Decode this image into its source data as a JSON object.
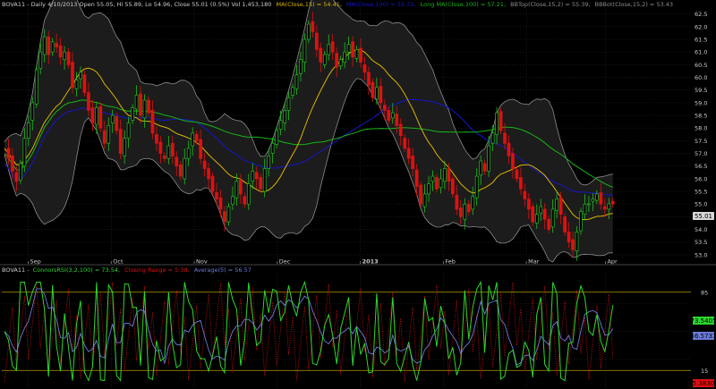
{
  "colors": {
    "background": "#000000",
    "grid": "#2a2a2a",
    "up_candle": "#1fbf1f",
    "down_candle": "#e01010",
    "bollinger": "#8c8c8c",
    "bollinger_fill": "#1c1c1c",
    "ma15": "#d8b400",
    "ma100": "#1616c8",
    "long_ma": "#18b418",
    "connors": "#2ed62e",
    "streak": "#e01010",
    "average": "#6a7ad8",
    "level_line": "#b59b00",
    "text": "#cccccc"
  },
  "price_panel": {
    "header": {
      "symbol_info": "BOVA11 - Daily 4/10/2013 Open 55.05, Hi 55.89, Lo 54.96, Close 55.01 (0.5%) Vol 1,453,180",
      "ma15": "MA(Close,15) = 54.41,",
      "ma100": "MA(Close,100) = 55.72,",
      "long_ma": "Long MA(Close,100) = 57.21,",
      "bb_top": "BBTop(Close,15,2) = 55.39,",
      "bb_bot": "BBBot(Close,15,2) = 53.43"
    },
    "last_price_label": "55.01",
    "y_ticks": [
      "62.5",
      "62.0",
      "61.5",
      "61.0",
      "60.5",
      "60.0",
      "59.5",
      "59.0",
      "58.5",
      "58.0",
      "57.5",
      "57.0",
      "56.5",
      "56.0",
      "55.5",
      "55.0",
      "54.5",
      "54.0",
      "53.5",
      "53.0"
    ],
    "x_labels": [
      "Sep",
      "Oct",
      "Nov",
      "Dec",
      "2013",
      "Feb",
      "Mar",
      "Apr"
    ]
  },
  "indicator_panel": {
    "header": {
      "symbol": "BOVA11 -",
      "connors": "ConnorsRSI(3,2,100) = 73.54,",
      "streak": "Closing Range = 5.38,",
      "average": "Average(5) = 56.57"
    },
    "levels": [
      "85",
      "15"
    ],
    "value_labels": {
      "connors": "73.5405",
      "average": "56.5731",
      "streak": "5.3830"
    }
  },
  "chart_data": [
    {
      "type": "candlestick",
      "title": "BOVA11 - Daily",
      "ylim": [
        52.75,
        62.7
      ],
      "y_ticks": [
        62.5,
        62.0,
        61.5,
        61.0,
        60.5,
        60.0,
        59.5,
        59.0,
        58.5,
        58.0,
        57.5,
        57.0,
        56.5,
        56.0,
        55.5,
        55.0,
        54.5,
        54.0,
        53.5,
        53.0
      ],
      "x_labels": [
        "Sep",
        "Oct",
        "Nov",
        "Dec",
        "2013",
        "Feb",
        "Mar",
        "Apr"
      ],
      "x_label_positions": [
        6,
        27,
        48,
        69,
        90,
        111,
        132,
        152
      ],
      "bars": 164,
      "last_close": 55.01,
      "series": [
        {
          "name": "Close",
          "values": [
            57.2,
            56.8,
            56.3,
            55.9,
            56.6,
            57.6,
            58.2,
            59.0,
            60.3,
            61.0,
            61.6,
            60.9,
            61.4,
            61.2,
            60.8,
            61.0,
            60.5,
            59.6,
            59.9,
            60.2,
            59.4,
            58.7,
            58.2,
            58.8,
            58.0,
            57.4,
            58.1,
            58.5,
            57.9,
            57.0,
            57.6,
            58.2,
            58.8,
            59.3,
            58.5,
            59.1,
            58.6,
            57.8,
            57.4,
            57.0,
            56.8,
            57.3,
            56.9,
            56.5,
            56.1,
            56.8,
            57.2,
            57.8,
            57.5,
            56.8,
            56.4,
            56.0,
            55.5,
            55.2,
            54.8,
            54.3,
            54.9,
            55.3,
            55.9,
            55.4,
            55.0,
            55.8,
            56.3,
            56.0,
            55.6,
            56.4,
            56.9,
            57.4,
            57.9,
            58.3,
            58.7,
            59.2,
            59.6,
            60.1,
            60.7,
            61.5,
            62.1,
            61.8,
            61.1,
            60.6,
            60.9,
            61.3,
            61.0,
            60.4,
            60.7,
            61.0,
            61.3,
            60.8,
            61.1,
            60.6,
            60.2,
            59.7,
            59.2,
            59.6,
            59.0,
            58.7,
            58.3,
            58.6,
            58.1,
            57.7,
            57.2,
            56.8,
            56.4,
            55.7,
            55.0,
            55.4,
            55.8,
            56.1,
            55.6,
            56.0,
            56.4,
            55.9,
            55.4,
            54.8,
            54.5,
            55.0,
            54.7,
            55.3,
            56.1,
            56.7,
            56.3,
            57.3,
            57.8,
            58.6,
            57.9,
            57.4,
            56.9,
            56.4,
            56.0,
            55.6,
            55.2,
            54.8,
            54.3,
            54.6,
            54.9,
            54.4,
            54.0,
            54.8,
            55.2,
            54.6,
            53.9,
            53.5,
            53.2,
            53.9,
            54.7,
            55.0,
            55.01,
            55.2,
            55.4,
            55.0,
            54.8,
            55.01,
            55.01,
            55.01,
            55.01,
            55.01,
            55.01,
            55.01,
            55.01,
            55.01,
            55.01,
            55.01
          ]
        },
        {
          "name": "MA(Close,15)",
          "values": []
        },
        {
          "name": "MA(Close,100)",
          "values": []
        },
        {
          "name": "Long MA(Close,100)",
          "values": []
        },
        {
          "name": "BBTop(Close,15,2)",
          "values": []
        },
        {
          "name": "BBBot(Close,15,2)",
          "values": []
        }
      ]
    },
    {
      "type": "line",
      "title": "BOVA11 - ConnorsRSI(3,2,100)",
      "ylim": [
        0,
        100
      ],
      "levels": [
        85,
        15
      ],
      "series": [
        {
          "name": "ConnorsRSI(3,2,100)",
          "last": 73.54
        },
        {
          "name": "Closing Range",
          "last": 5.38
        },
        {
          "name": "Average(5)",
          "last": 56.57
        }
      ]
    }
  ]
}
